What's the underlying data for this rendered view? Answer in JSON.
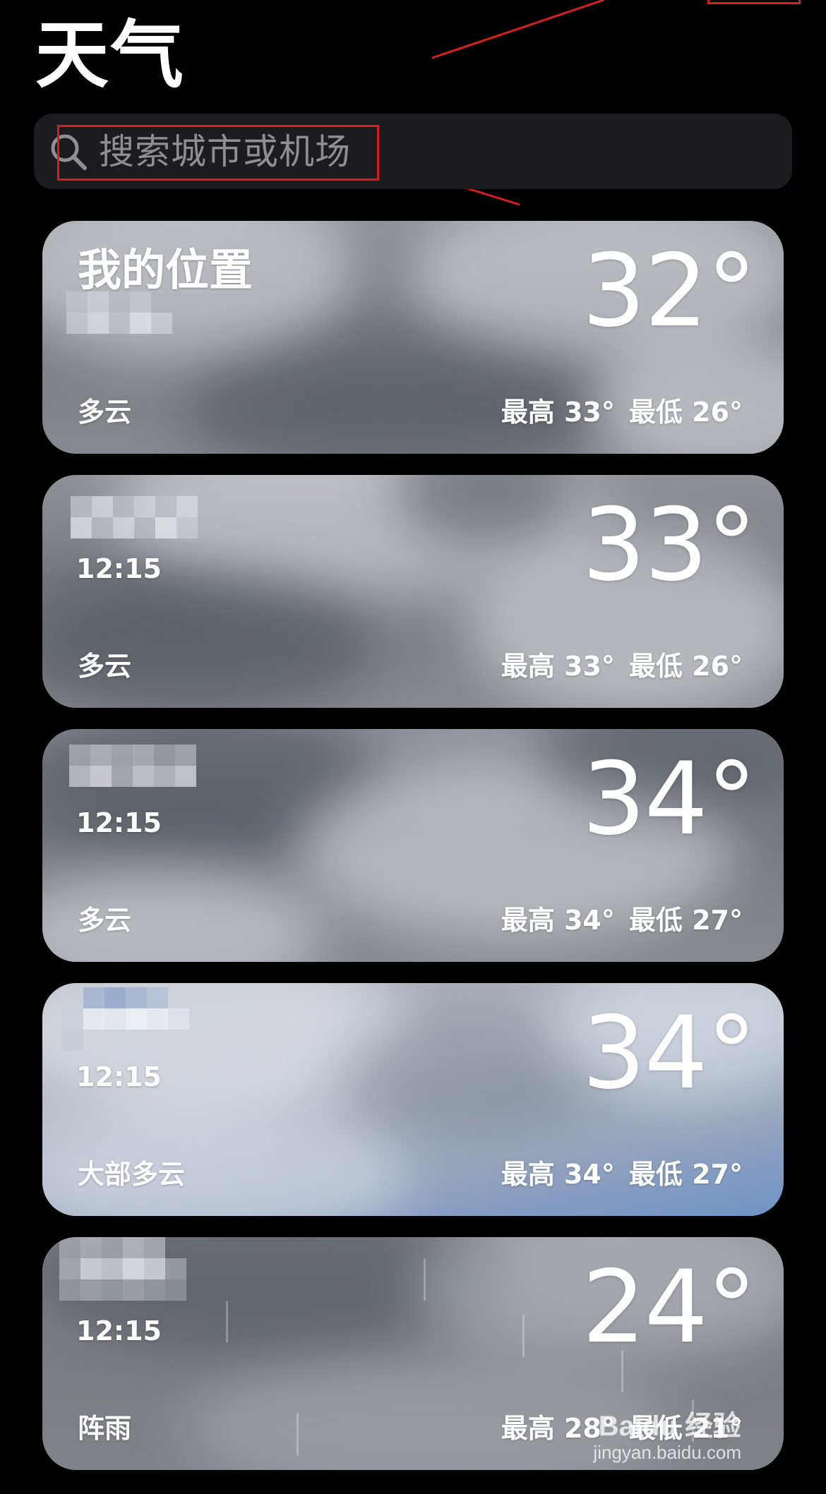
{
  "app": {
    "title": "天气"
  },
  "search": {
    "placeholder": "搜索城市或机场",
    "icon": "search-icon"
  },
  "cards": [
    {
      "name": "我的位置",
      "time": "",
      "temperature": "32°",
      "condition": "多云",
      "high": "最高 33°",
      "low": "最低 26°",
      "background": "cloudy"
    },
    {
      "name": "",
      "time": "12:15",
      "temperature": "33°",
      "condition": "多云",
      "high": "最高 33°",
      "low": "最低 26°",
      "background": "cloudy"
    },
    {
      "name": "",
      "time": "12:15",
      "temperature": "34°",
      "condition": "多云",
      "high": "最高 34°",
      "low": "最低 27°",
      "background": "cloudy"
    },
    {
      "name": "",
      "time": "12:15",
      "temperature": "34°",
      "condition": "大部多云",
      "high": "最高 34°",
      "low": "最低 27°",
      "background": "mostly-cloudy"
    },
    {
      "name": "",
      "time": "12:15",
      "temperature": "24°",
      "condition": "阵雨",
      "high": "最高 28°",
      "low": "最低 21°",
      "background": "showers"
    }
  ],
  "annotations": {
    "color": "#d81e1e"
  },
  "watermark": {
    "top": "Baidu 经验",
    "bottom": "jingyan.baidu.com"
  },
  "colors": {
    "background": "#000000",
    "search_bar": "#1c1c1e",
    "placeholder": "#8e8e93"
  }
}
